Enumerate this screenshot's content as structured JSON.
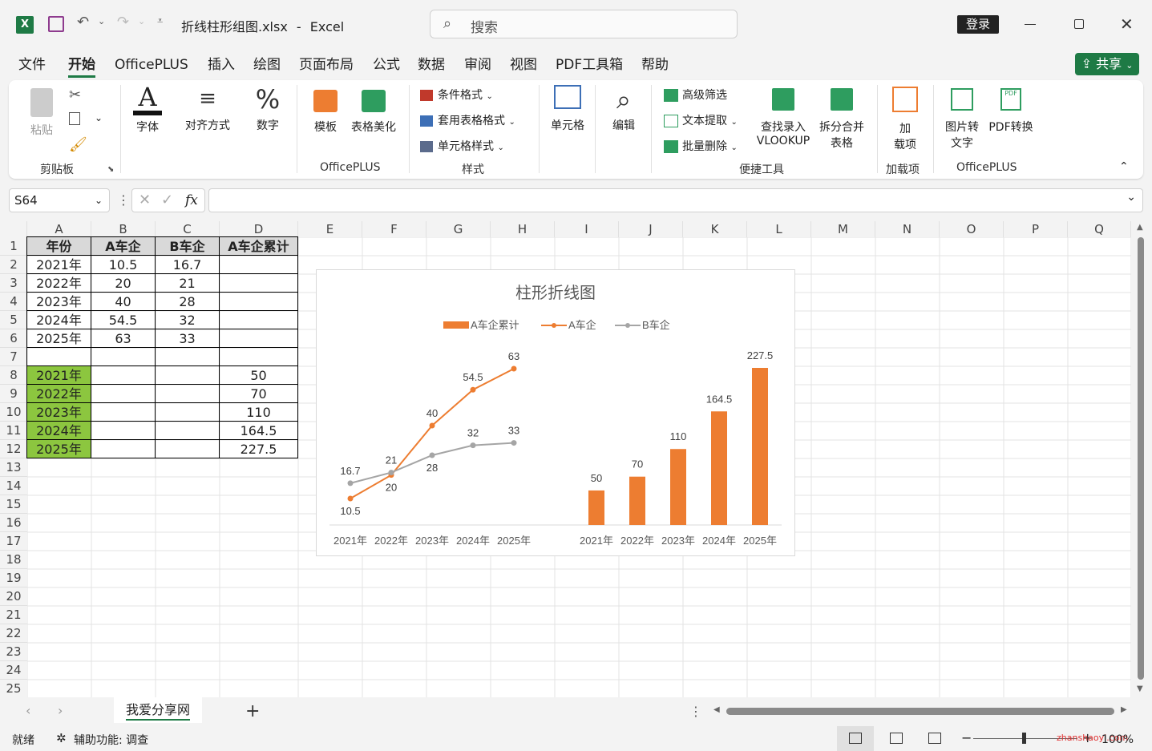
{
  "titlebar": {
    "filename": "折线柱形组图.xlsx",
    "separator": "-",
    "app": "Excel",
    "search_placeholder": "搜索",
    "login": "登录"
  },
  "menu": {
    "tabs": [
      "文件",
      "开始",
      "OfficePLUS",
      "插入",
      "绘图",
      "页面布局",
      "公式",
      "数据",
      "审阅",
      "视图",
      "PDF工具箱",
      "帮助"
    ],
    "share": "共享"
  },
  "ribbon": {
    "paste": "粘贴",
    "clipboard_group": "剪贴板",
    "font": "字体",
    "align": "对齐方式",
    "number": "数字",
    "template": "模板",
    "table_beautify": "表格美化",
    "officeplus_group": "OfficePLUS",
    "cond_format": "条件格式",
    "table_format": "套用表格格式",
    "cell_style": "单元格样式",
    "styles_group": "样式",
    "cells": "单元格",
    "edit": "编辑",
    "adv_filter": "高级筛选",
    "text_extract": "文本提取",
    "batch_delete": "批量删除",
    "lookup_line1": "查找录入",
    "lookup_line2": "VLOOKUP",
    "split_line1": "拆分合并",
    "split_line2": "表格",
    "tools_group": "便捷工具",
    "addin_line1": "加",
    "addin_line2": "载项",
    "addin_group": "加载项",
    "img2text_line1": "图片转",
    "img2text_line2": "文字",
    "pdfconv": "PDF转换",
    "officeplus2_group": "OfficePLUS"
  },
  "formula_bar": {
    "namebox": "S64",
    "fx": "fx",
    "value": ""
  },
  "sheet": {
    "columns": [
      "A",
      "B",
      "C",
      "D",
      "E",
      "F",
      "G",
      "H",
      "I",
      "J",
      "K",
      "L",
      "M",
      "N",
      "O",
      "P",
      "Q"
    ],
    "rows": [
      "1",
      "2",
      "3",
      "4",
      "5",
      "6",
      "7",
      "8",
      "9",
      "10",
      "11",
      "12",
      "13",
      "14",
      "15",
      "16",
      "17",
      "18",
      "19",
      "20",
      "21",
      "22",
      "23",
      "24",
      "25"
    ],
    "header_row": [
      "年份",
      "A车企",
      "B车企",
      "A车企累计"
    ],
    "table1": [
      [
        "2021年",
        "10.5",
        "16.7",
        ""
      ],
      [
        "2022年",
        "20",
        "21",
        ""
      ],
      [
        "2023年",
        "40",
        "28",
        ""
      ],
      [
        "2024年",
        "54.5",
        "32",
        ""
      ],
      [
        "2025年",
        "63",
        "33",
        ""
      ]
    ],
    "table2": [
      [
        "2021年",
        "",
        "",
        "50"
      ],
      [
        "2022年",
        "",
        "",
        "70"
      ],
      [
        "2023年",
        "",
        "",
        "110"
      ],
      [
        "2024年",
        "",
        "",
        "164.5"
      ],
      [
        "2025年",
        "",
        "",
        "227.5"
      ]
    ],
    "highlight_color": "#8cc63f"
  },
  "chart_data": {
    "type": "bar",
    "title": "柱形折线图",
    "legend": [
      "A车企累计",
      "A车企",
      "B车企"
    ],
    "legend_position": "top",
    "line_categories": [
      "2021年",
      "2022年",
      "2023年",
      "2024年",
      "2025年"
    ],
    "bar_categories": [
      "2021年",
      "2022年",
      "2023年",
      "2024年",
      "2025年"
    ],
    "series": [
      {
        "name": "A车企累计",
        "kind": "bar",
        "color": "#ed7d31",
        "values": [
          50,
          70,
          110,
          164.5,
          227.5
        ]
      },
      {
        "name": "A车企",
        "kind": "line",
        "color": "#ed7d31",
        "values": [
          10.5,
          20,
          40,
          54.5,
          63
        ]
      },
      {
        "name": "B车企",
        "kind": "line",
        "color": "#a5a5a5",
        "values": [
          16.7,
          21,
          28,
          32,
          33
        ]
      }
    ]
  },
  "sheet_tabs": {
    "active": "我爱分享网",
    "add": "+"
  },
  "statusbar": {
    "ready": "就绪",
    "accessibility": "辅助功能: 调查",
    "zoom": "100%",
    "watermark": "zhanshaoyi.com"
  }
}
